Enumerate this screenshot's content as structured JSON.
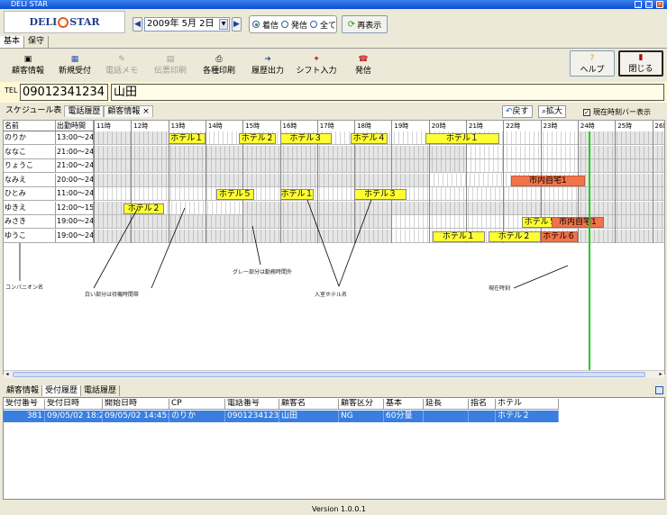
{
  "window": {
    "title": "DELI STAR"
  },
  "logo": {
    "text_left": "DELI",
    "text_right": "STAR"
  },
  "date": {
    "value": "2009年  5月  2日"
  },
  "filter": {
    "options": [
      "着信",
      "発信",
      "全て"
    ],
    "selected": "着信"
  },
  "refresh_label": "再表示",
  "main_tabs": [
    "基本",
    "保守"
  ],
  "toolbar": {
    "customer": "顧客情報",
    "new_reception": "新規受付",
    "phone_memo": "電話メモ",
    "slip_print": "伝票印刷",
    "various_print": "各種印刷",
    "history_output": "履歴出力",
    "shift_input": "シフト入力",
    "outgoing": "発信",
    "help": "ヘルプ",
    "close": "閉じる"
  },
  "tel": {
    "label": "TEL",
    "number": "09012341234",
    "name": "山田"
  },
  "schedule_tabs": [
    "スケジュール表",
    "電話履歴",
    "顧客情報"
  ],
  "schedule_close": "×",
  "back_label": "戻す",
  "zoom_label": "拡大",
  "now_bar_checkbox": "現在時刻バー表示",
  "grid": {
    "col_name": "名前",
    "col_time": "出勤時間",
    "hours": [
      "11時",
      "12時",
      "13時",
      "14時",
      "15時",
      "16時",
      "17時",
      "18時",
      "19時",
      "20時",
      "21時",
      "22時",
      "23時",
      "24時",
      "25時",
      "26時"
    ],
    "rows": [
      {
        "name": "のりか",
        "time": "13:00〜24:00"
      },
      {
        "name": "ななこ",
        "time": "21:00〜24:00"
      },
      {
        "name": "りょうこ",
        "time": "21:00〜24:00"
      },
      {
        "name": "なみえ",
        "time": "20:00〜24:00"
      },
      {
        "name": "ひとみ",
        "time": "11:00〜24:00"
      },
      {
        "name": "ゆきえ",
        "time": "12:00〜15:00"
      },
      {
        "name": "みさき",
        "time": "19:00〜24:00"
      },
      {
        "name": "ゆうこ",
        "time": "19:00〜24:00"
      }
    ],
    "bookings": [
      {
        "row": 0,
        "label": "ホテル１",
        "kind": "hotel"
      },
      {
        "row": 0,
        "label": "ホテル２",
        "kind": "hotel"
      },
      {
        "row": 0,
        "label": "ホテル３",
        "kind": "hotel"
      },
      {
        "row": 0,
        "label": "ホテル４",
        "kind": "hotel"
      },
      {
        "row": 0,
        "label": "ホテル１",
        "kind": "hotel"
      },
      {
        "row": 3,
        "label": "市内自宅1",
        "kind": "home"
      },
      {
        "row": 4,
        "label": "ホテル５",
        "kind": "hotel"
      },
      {
        "row": 4,
        "label": "ホテル１",
        "kind": "hotel"
      },
      {
        "row": 4,
        "label": "ホテル３",
        "kind": "hotel"
      },
      {
        "row": 5,
        "label": "ホテル２",
        "kind": "hotel"
      },
      {
        "row": 6,
        "label": "ホテル５",
        "kind": "hotel"
      },
      {
        "row": 6,
        "label": "市内自宅1",
        "kind": "home"
      },
      {
        "row": 7,
        "label": "ホテル１",
        "kind": "hotel"
      },
      {
        "row": 7,
        "label": "ホテル２",
        "kind": "hotel"
      },
      {
        "row": 7,
        "label": "ホテル６",
        "kind": "home"
      }
    ],
    "annotations": {
      "companion": "コンパニオン名",
      "white": "白い部分は待機時間帯",
      "gray": "グレー部分は勤務時間外",
      "hotel": "入室ホテル名",
      "now": "現在時刻"
    }
  },
  "bottom_tabs": [
    "顧客情報",
    "受付履歴",
    "電話履歴"
  ],
  "table": {
    "headers": [
      "受付番号",
      "受付日時",
      "開始日時",
      "CP",
      "電話番号",
      "顧客名",
      "顧客区分",
      "基本",
      "延長",
      "指名",
      "ホテル"
    ],
    "rows": [
      [
        "381",
        "09/05/02 18:21",
        "09/05/02 14:45:00",
        "のりか",
        "09012341234",
        "山田",
        "NG",
        "60分量",
        "",
        "",
        "ホテル２"
      ]
    ]
  },
  "version": "Version 1.0.0.1"
}
